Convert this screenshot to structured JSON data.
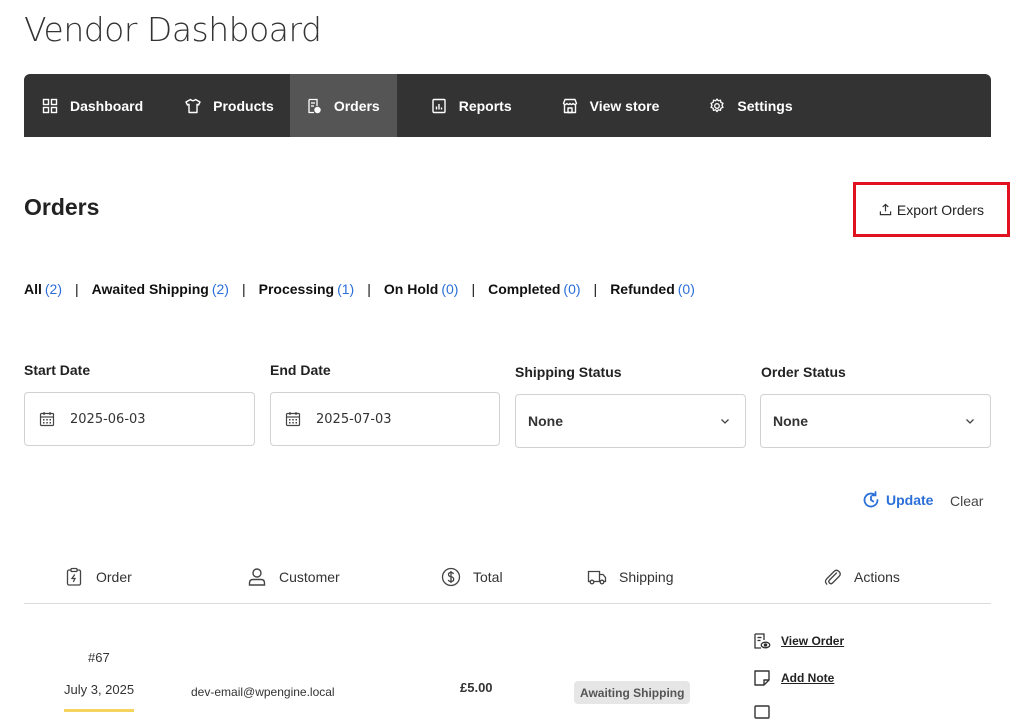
{
  "page_title": "Vendor Dashboard",
  "nav": {
    "items": [
      {
        "label": "Dashboard",
        "icon": "grid-icon"
      },
      {
        "label": "Products",
        "icon": "tshirt-icon"
      },
      {
        "label": "Orders",
        "icon": "orders-icon",
        "active": true
      },
      {
        "label": "Reports",
        "icon": "report-icon"
      },
      {
        "label": "View store",
        "icon": "store-icon"
      },
      {
        "label": "Settings",
        "icon": "gear-icon"
      }
    ]
  },
  "orders": {
    "title": "Orders",
    "export_label": "Export Orders"
  },
  "status_filters": [
    {
      "label": "All",
      "count": "(2)"
    },
    {
      "label": "Awaited Shipping",
      "count": "(2)"
    },
    {
      "label": "Processing",
      "count": "(1)"
    },
    {
      "label": "On Hold",
      "count": "(0)"
    },
    {
      "label": "Completed",
      "count": "(0)"
    },
    {
      "label": "Refunded",
      "count": "(0)"
    }
  ],
  "filters": {
    "start_date": {
      "label": "Start Date",
      "value": "2025-06-03"
    },
    "end_date": {
      "label": "End Date",
      "value": "2025-07-03"
    },
    "shipping_status": {
      "label": "Shipping Status",
      "value": "None"
    },
    "order_status": {
      "label": "Order Status",
      "value": "None"
    },
    "update_label": "Update",
    "clear_label": "Clear"
  },
  "table": {
    "headers": {
      "order": "Order",
      "customer": "Customer",
      "total": "Total",
      "shipping": "Shipping",
      "actions": "Actions"
    },
    "rows": [
      {
        "order_no": "#67",
        "date": "July 3, 2025",
        "customer": "dev-email@wpengine.local",
        "total": "£5.00",
        "shipping": "Awaiting Shipping",
        "actions": [
          "View Order",
          "Add Note"
        ]
      }
    ]
  },
  "colors": {
    "nav_bg": "#333333",
    "nav_active": "#555555",
    "accent": "#2b6fd8",
    "highlight_border": "#e0121f"
  }
}
